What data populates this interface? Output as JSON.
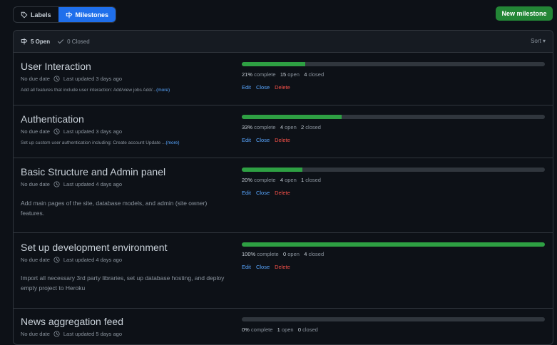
{
  "tabs": {
    "labels": "Labels",
    "milestones": "Milestones"
  },
  "new_milestone": "New milestone",
  "header": {
    "open": "5 Open",
    "closed": "0 Closed",
    "sort": "Sort ▾"
  },
  "actions": {
    "edit": "Edit",
    "close": "Close",
    "delete": "Delete"
  },
  "colors": {
    "accent": "#1f6feb",
    "success": "#238636",
    "progress": "#2ea043",
    "danger": "#f85149",
    "link": "#58a6ff"
  },
  "milestones": [
    {
      "title": "User Interaction",
      "due": "No due date",
      "updated": "Last updated 3 days ago",
      "desc": "Add all features that include user interaction: Add/view jobs Add/...",
      "more": "(more)",
      "percent": "21%",
      "percent_label": "complete",
      "open": "15",
      "open_label": "open",
      "closed": "4",
      "closed_label": "closed",
      "progress": 0.21
    },
    {
      "title": "Authentication",
      "due": "No due date",
      "updated": "Last updated 3 days ago",
      "desc": "Set up custom user authentication including: Create account Update ...",
      "more": "(more)",
      "percent": "33%",
      "percent_label": "complete",
      "open": "4",
      "open_label": "open",
      "closed": "2",
      "closed_label": "closed",
      "progress": 0.33
    },
    {
      "title": "Basic Structure and Admin panel",
      "due": "No due date",
      "updated": "Last updated 4 days ago",
      "desc": "Add main pages of the site, database models, and admin (site owner) features.",
      "percent": "20%",
      "percent_label": "complete",
      "open": "4",
      "open_label": "open",
      "closed": "1",
      "closed_label": "closed",
      "progress": 0.2
    },
    {
      "title": "Set up development environment",
      "due": "No due date",
      "updated": "Last updated 4 days ago",
      "desc": "Import all necessary 3rd party libraries, set up database hosting, and deploy empty project to Heroku",
      "percent": "100%",
      "percent_label": "complete",
      "open": "0",
      "open_label": "open",
      "closed": "4",
      "closed_label": "closed",
      "progress": 1.0
    },
    {
      "title": "News aggregation feed",
      "due": "No due date",
      "updated": "Last updated 5 days ago",
      "percent": "0%",
      "percent_label": "complete",
      "open": "1",
      "open_label": "open",
      "closed": "0",
      "closed_label": "closed",
      "progress": 0.0
    }
  ]
}
